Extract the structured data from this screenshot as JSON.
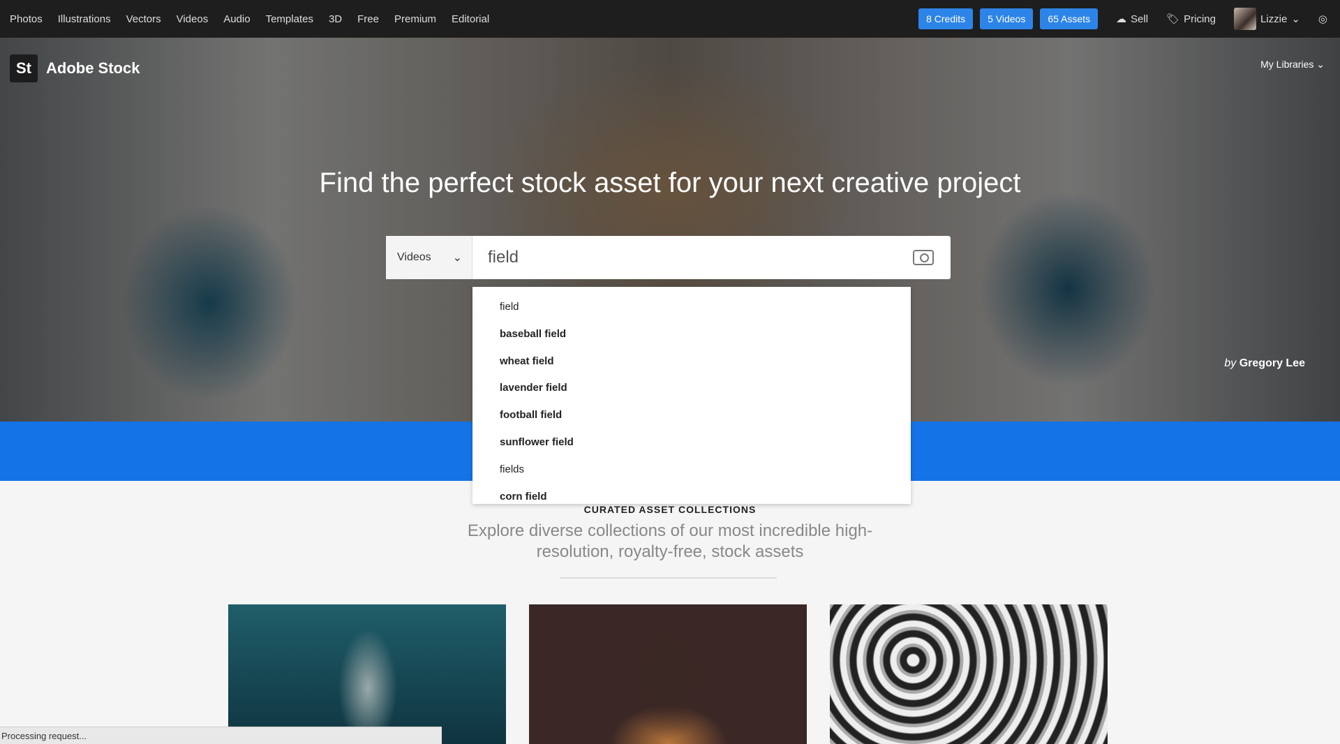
{
  "nav": {
    "links": [
      "Photos",
      "Illustrations",
      "Vectors",
      "Videos",
      "Audio",
      "Templates",
      "3D",
      "Free",
      "Premium",
      "Editorial"
    ],
    "pills": [
      "8 Credits",
      "5 Videos",
      "65 Assets"
    ],
    "sell": "Sell",
    "pricing": "Pricing",
    "user": "Lizzie"
  },
  "brand": {
    "mark": "St",
    "name": "Adobe Stock"
  },
  "my_libraries": "My Libraries",
  "hero": {
    "headline": "Find the perfect stock asset for your next creative project",
    "credit_by": "by",
    "credit_name": "Gregory Lee"
  },
  "search": {
    "category": "Videos",
    "query": "field"
  },
  "suggestions": [
    {
      "text": "field",
      "bold": false
    },
    {
      "text": "baseball field",
      "bold": true
    },
    {
      "text": "wheat field",
      "bold": true
    },
    {
      "text": "lavender field",
      "bold": true
    },
    {
      "text": "football field",
      "bold": true
    },
    {
      "text": "sunflower field",
      "bold": true
    },
    {
      "text": "fields",
      "bold": false
    },
    {
      "text": "corn field",
      "bold": true
    }
  ],
  "collections": {
    "heading": "CURATED ASSET COLLECTIONS",
    "description": "Explore diverse collections of our most incredible high-resolution, royalty-free, stock assets"
  },
  "status": "Processing request...",
  "colors": {
    "accent": "#1473e6",
    "pill": "#2d84e8",
    "nav_bg": "#1e1e1e"
  }
}
